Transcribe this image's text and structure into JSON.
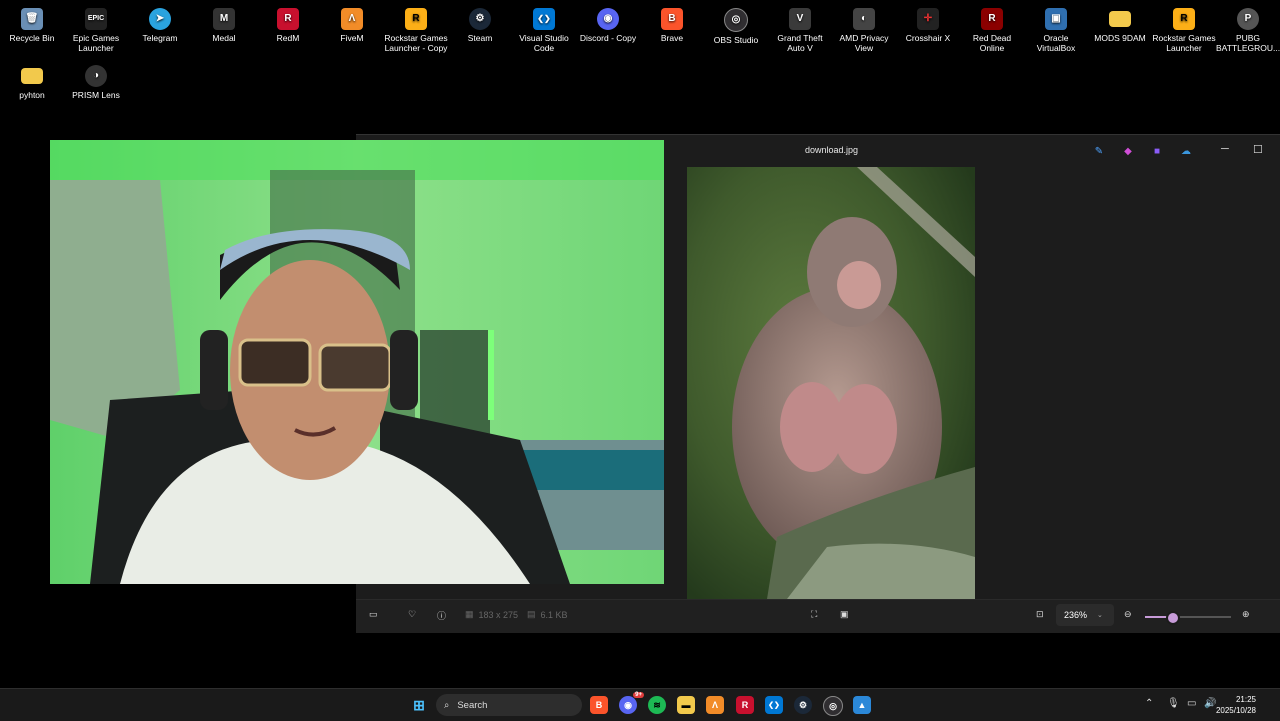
{
  "desktop_icons": [
    {
      "label": "Recycle Bin",
      "icon": "recycle-bin-icon",
      "color": "#6a8fb5",
      "glyph": "🗑"
    },
    {
      "label": "Epic Games Launcher",
      "icon": "epic-games-icon",
      "color": "#222222",
      "glyph": "EPIC"
    },
    {
      "label": "Telegram",
      "icon": "telegram-icon",
      "color": "#2aa3df",
      "glyph": "➤"
    },
    {
      "label": "Medal",
      "icon": "medal-icon",
      "color": "#333333",
      "glyph": "M"
    },
    {
      "label": "RedM",
      "icon": "redm-icon",
      "color": "#c8102e",
      "glyph": "R"
    },
    {
      "label": "FiveM",
      "icon": "fivem-icon",
      "color": "#f28c28",
      "glyph": "Λ"
    },
    {
      "label": "Rockstar Games Launcher - Copy",
      "icon": "rockstar-icon",
      "color": "#fcaf17",
      "glyph": "R"
    },
    {
      "label": "Steam",
      "icon": "steam-icon",
      "color": "#1b2838",
      "glyph": "⚙"
    },
    {
      "label": "Visual Studio Code",
      "icon": "vscode-icon",
      "color": "#0078d4",
      "glyph": "❮❯"
    },
    {
      "label": "Discord - Copy",
      "icon": "discord-icon",
      "color": "#5865f2",
      "glyph": "◉"
    },
    {
      "label": "Brave",
      "icon": "brave-icon",
      "color": "#fb542b",
      "glyph": "B"
    },
    {
      "label": "OBS Studio",
      "icon": "obs-icon",
      "color": "#302e31",
      "glyph": "◎"
    },
    {
      "label": "Grand Theft Auto V",
      "icon": "gta-icon",
      "color": "#3a3a3a",
      "glyph": "V"
    },
    {
      "label": "AMD Privacy View",
      "icon": "amd-icon",
      "color": "#444444",
      "glyph": "◐"
    },
    {
      "label": "Crosshair X",
      "icon": "crosshair-icon",
      "color": "#222222",
      "glyph": "✛"
    },
    {
      "label": "Red Dead Online",
      "icon": "red-dead-icon",
      "color": "#8b0000",
      "glyph": "R"
    },
    {
      "label": "Oracle VirtualBox",
      "icon": "virtualbox-icon",
      "color": "#2f6fb0",
      "glyph": "▣"
    },
    {
      "label": "MODS 9DAM",
      "icon": "folder-icon",
      "color": "#f2c94c",
      "glyph": "▬"
    },
    {
      "label": "Rockstar Games Launcher",
      "icon": "rockstar-icon",
      "color": "#fcaf17",
      "glyph": "R"
    },
    {
      "label": "PUBG BATTLEGROU...",
      "icon": "pubg-icon",
      "color": "#555555",
      "glyph": "P"
    },
    {
      "label": "pyhton",
      "icon": "folder-icon",
      "color": "#f2c94c",
      "glyph": "▬"
    },
    {
      "label": "PRISM Lens",
      "icon": "prism-lens-icon",
      "color": "#333333",
      "glyph": "◑"
    }
  ],
  "photos": {
    "title": "download.jpg",
    "dimensions": "183 x 275",
    "size": "6.1 KB",
    "zoom": "236%",
    "zoom_fraction": 0.32
  },
  "taskbar": {
    "search_placeholder": "Search",
    "discord_badge": "9+",
    "time": "21:25",
    "date": "2025/10/28"
  }
}
